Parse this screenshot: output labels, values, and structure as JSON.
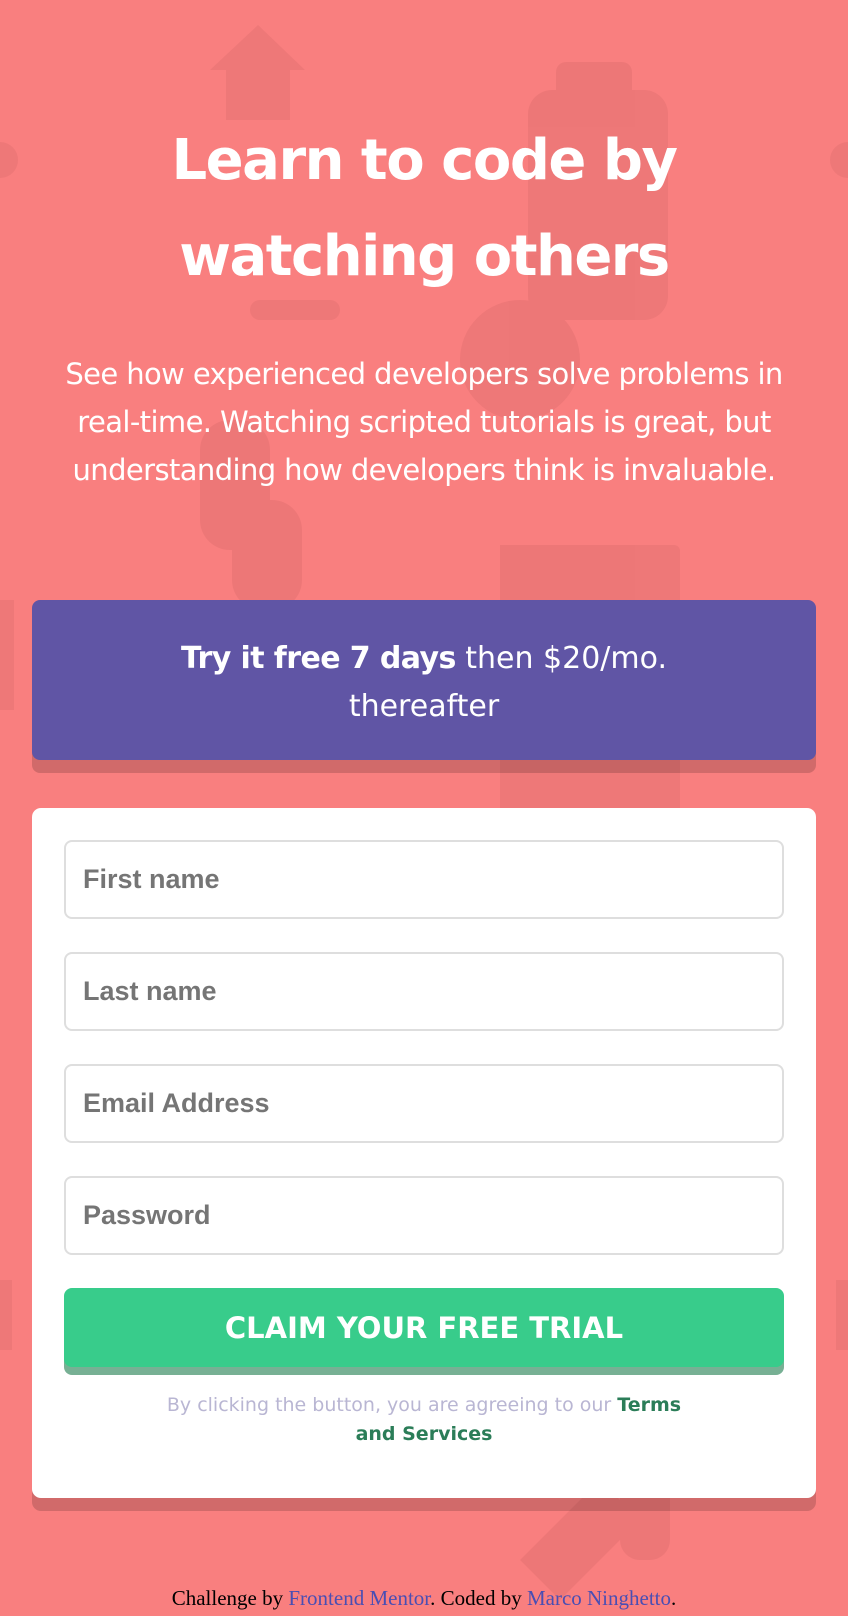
{
  "hero": {
    "title_line1": "Learn to code by",
    "title_line2": "watching others",
    "description": "See how experienced developers solve problems in real-time. Watching scripted tutorials is great, but understanding how developers think is invaluable."
  },
  "offer": {
    "bold": "Try it free 7 days",
    "rest": "then $20/mo.",
    "line2": "thereafter"
  },
  "form": {
    "first_name_placeholder": "First name",
    "last_name_placeholder": "Last name",
    "email_placeholder": "Email Address",
    "password_placeholder": "Password",
    "submit_label": "CLAIM YOUR FREE TRIAL",
    "terms_prefix": "By clicking the button, you are agreeing to our",
    "terms_link": "Terms and Services"
  },
  "footer": {
    "prefix": "Challenge by",
    "challenge_link": "Frontend Mentor",
    "middle": ". Coded by",
    "author_link": "Marco Ninghetto",
    "suffix": "."
  },
  "colors": {
    "background": "#f97f7f",
    "offer_banner": "#6055a5",
    "cta": "#38cc8b",
    "terms_link": "#2b7d58"
  },
  "icons": {
    "background_pattern": "decorative-code-pattern"
  }
}
